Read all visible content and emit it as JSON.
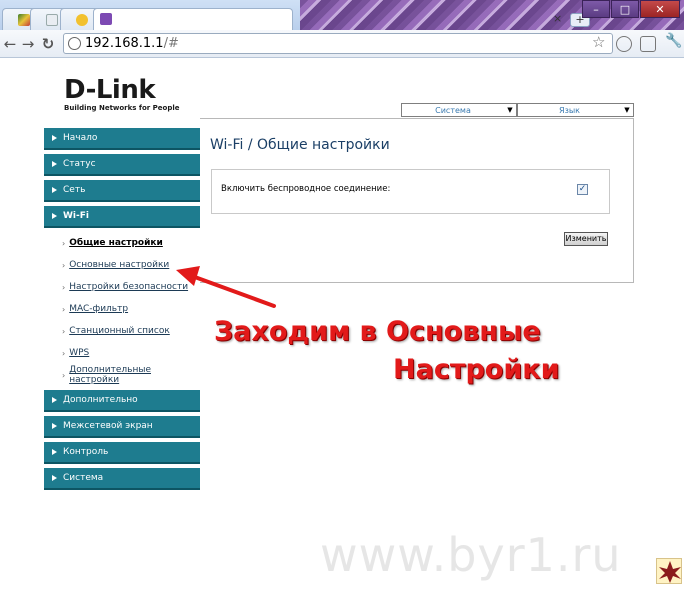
{
  "browser": {
    "tabs": [
      {
        "icon": "google-maps-icon",
        "active": false
      },
      {
        "icon": "network-icon",
        "active": false
      },
      {
        "icon": "smiley-icon",
        "active": false
      },
      {
        "icon": "chart-icon",
        "active": true
      }
    ],
    "tab_close": "×",
    "new_tab": "+",
    "url_host": "192.168.1.1",
    "url_rest": "/#",
    "window_buttons": {
      "minimize": "–",
      "maximize": "□",
      "close": "✕"
    },
    "accent": "#8e58b0"
  },
  "router": {
    "logo": {
      "brand": "D-Link",
      "tagline": "Building Networks for People"
    },
    "selects": {
      "system": "Система",
      "language": "Язык"
    },
    "sidebar": {
      "sections": [
        {
          "label": "Начало"
        },
        {
          "label": "Статус"
        },
        {
          "label": "Сеть"
        },
        {
          "label": "Wi-Fi"
        }
      ],
      "wifi_items": [
        {
          "label": "Общие настройки"
        },
        {
          "label": "Основные настройки"
        },
        {
          "label": "Настройки безопасности"
        },
        {
          "label": "MAC-фильтр"
        },
        {
          "label": "Станционный список"
        },
        {
          "label": "WPS"
        },
        {
          "label": "Дополнительные настройки"
        }
      ],
      "sections_after": [
        {
          "label": "Дополнительно"
        },
        {
          "label": "Межсетевой экран"
        },
        {
          "label": "Контроль"
        },
        {
          "label": "Система"
        }
      ],
      "color": "#1e7c8f"
    },
    "content": {
      "title": "Wi-Fi /  Общие настройки",
      "enable_label": "Включить беспроводное соединение:",
      "enable_checked": true,
      "check_mark": "✓",
      "apply_button": "Изменить"
    }
  },
  "annotation": {
    "line1": "Заходим в Основные",
    "line2": "Настройки",
    "color": "#e21a1a"
  },
  "watermark": "www.byr1.ru"
}
